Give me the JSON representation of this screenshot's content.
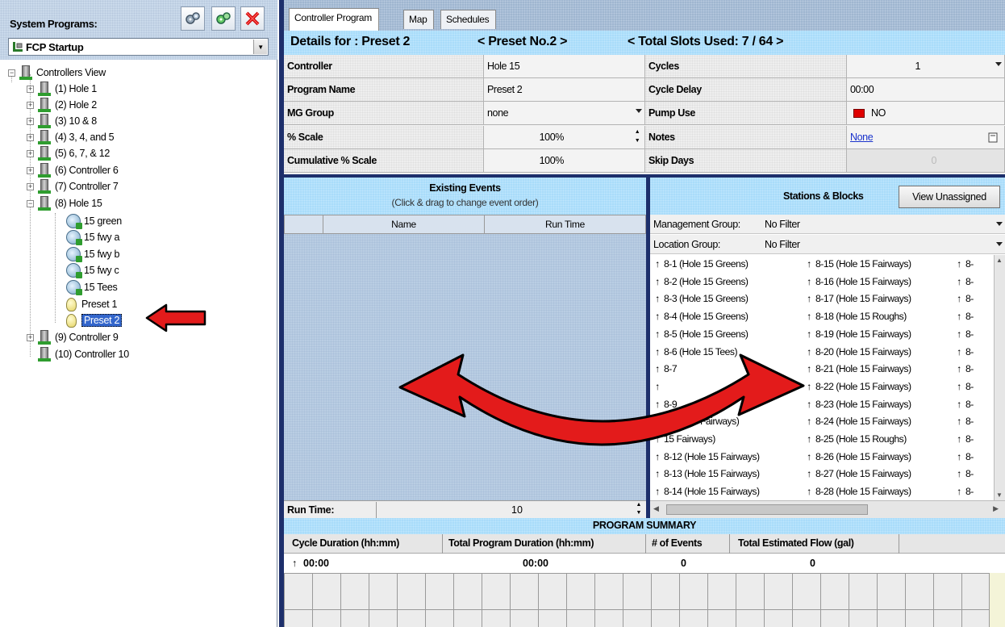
{
  "left_panel": {
    "system_programs_label": "System Programs:",
    "selected_program": "FCP Startup",
    "tree": {
      "root": "Controllers View",
      "items": [
        {
          "label": "(1)  Hole 1"
        },
        {
          "label": "(2)  Hole 2"
        },
        {
          "label": "(3)  10 & 8"
        },
        {
          "label": "(4)  3, 4, and 5"
        },
        {
          "label": "(5)  6, 7, & 12"
        },
        {
          "label": "(6)  Controller 6"
        },
        {
          "label": "(7)  Controller 7"
        },
        {
          "label": "(8)  Hole 15"
        },
        {
          "label": "15 green"
        },
        {
          "label": "15 fwy a"
        },
        {
          "label": "15 fwy b"
        },
        {
          "label": "15 fwy c"
        },
        {
          "label": "15 Tees"
        },
        {
          "label": "Preset 1"
        },
        {
          "label": "Preset 2"
        },
        {
          "label": "(9)  Controller 9"
        },
        {
          "label": "(10)  Controller 10"
        }
      ]
    }
  },
  "tabs": [
    {
      "label": "Controller Program"
    },
    {
      "label": "Map"
    },
    {
      "label": "Schedules"
    }
  ],
  "details": {
    "details_for": "Details for :  Preset 2",
    "preset_no": "< Preset No.2 >",
    "slots": "< Total Slots Used: 7 / 64 >"
  },
  "fields": {
    "controller_label": "Controller",
    "controller_value": "Hole 15",
    "program_name_label": "Program Name",
    "program_name_value": "Preset 2",
    "mg_group_label": "MG Group",
    "mg_group_value": "none",
    "scale_label": "% Scale",
    "scale_value": "100%",
    "cumulative_label": "Cumulative % Scale",
    "cumulative_value": "100%",
    "cycles_label": "Cycles",
    "cycles_value": "1",
    "cycle_delay_label": "Cycle Delay",
    "cycle_delay_value": "00:00",
    "pump_use_label": "Pump Use",
    "pump_use_value": "NO",
    "notes_label": "Notes",
    "notes_value": "None",
    "skip_days_label": "Skip Days",
    "skip_days_value": "0"
  },
  "events": {
    "title": "Existing Events",
    "subtitle": "(Click & drag to change event order)",
    "col_name": "Name",
    "col_run_time": "Run Time",
    "run_time_label": "Run Time:",
    "run_time_value": "10"
  },
  "stations": {
    "title": "Stations & Blocks",
    "view_unassigned": "View Unassigned",
    "mgmt_group_label": "Management Group:",
    "mgmt_group_value": "No Filter",
    "location_group_label": "Location Group:",
    "location_group_value": "No Filter",
    "col1": [
      "8-1  (Hole 15 Greens)",
      "8-2  (Hole 15 Greens)",
      "8-3  (Hole 15 Greens)",
      "8-4  (Hole 15 Greens)",
      "8-5  (Hole 15 Greens)",
      "8-6  (Hole 15 Tees)",
      "8-7",
      "",
      "8-9",
      "(Hole 15 Fairways)",
      "15 Fairways)",
      "8-12  (Hole 15 Fairways)",
      "8-13  (Hole 15 Fairways)",
      "8-14  (Hole 15 Fairways)"
    ],
    "col2": [
      "8-15  (Hole 15 Fairways)",
      "8-16  (Hole 15 Fairways)",
      "8-17  (Hole 15 Fairways)",
      "8-18  (Hole 15 Roughs)",
      "8-19  (Hole 15 Fairways)",
      "8-20  (Hole 15 Fairways)",
      "8-21  (Hole 15 Fairways)",
      "8-22  (Hole 15 Fairways)",
      "8-23  (Hole 15 Fairways)",
      "8-24  (Hole 15 Fairways)",
      "8-25  (Hole 15 Roughs)",
      "8-26  (Hole 15 Fairways)",
      "8-27  (Hole 15 Fairways)",
      "8-28  (Hole 15 Fairways)"
    ],
    "col3": [
      "8-",
      "8-",
      "8-",
      "8-",
      "8-",
      "8-",
      "8-",
      "8-",
      "8-",
      "8-",
      "8-",
      "8-",
      "8-",
      "8-"
    ]
  },
  "summary": {
    "title": "PROGRAM SUMMARY",
    "col_cycle": "Cycle Duration (hh:mm)",
    "col_total": "Total Program Duration (hh:mm)",
    "col_events": "# of Events",
    "col_flow": "Total Estimated Flow (gal)",
    "val_cycle": "00:00",
    "val_total": "00:00",
    "val_events": "0",
    "val_flow": "0"
  },
  "colors": {
    "accent_blue": "#a9dcfa",
    "dark_border": "#1d2f6b",
    "arrow_red": "#e31b1b",
    "pump_red": "#e00000"
  }
}
